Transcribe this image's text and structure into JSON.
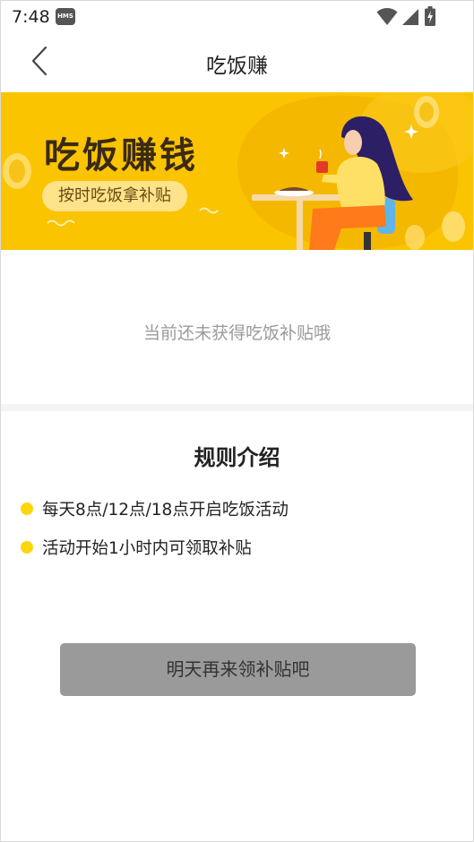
{
  "status_bar": {
    "time": "7:48",
    "badge": "HMS",
    "icons": [
      "wifi-icon",
      "signal-icon",
      "battery-charging-icon"
    ]
  },
  "nav": {
    "title": "吃饭赚",
    "back_icon": "chevron-left-icon"
  },
  "banner": {
    "title": "吃饭赚钱",
    "subtitle": "按时吃饭拿补贴",
    "background_color": "#fbc400"
  },
  "empty_state": {
    "message": "当前还未获得吃饭补贴哦"
  },
  "rules": {
    "title": "规则介绍",
    "items": [
      "每天8点/12点/18点开启吃饭活动",
      "活动开始1小时内可领取补贴"
    ],
    "bullet_color": "#ffd60a"
  },
  "action_button": {
    "label": "明天再来领补贴吧",
    "color": "#9a9a9a"
  }
}
